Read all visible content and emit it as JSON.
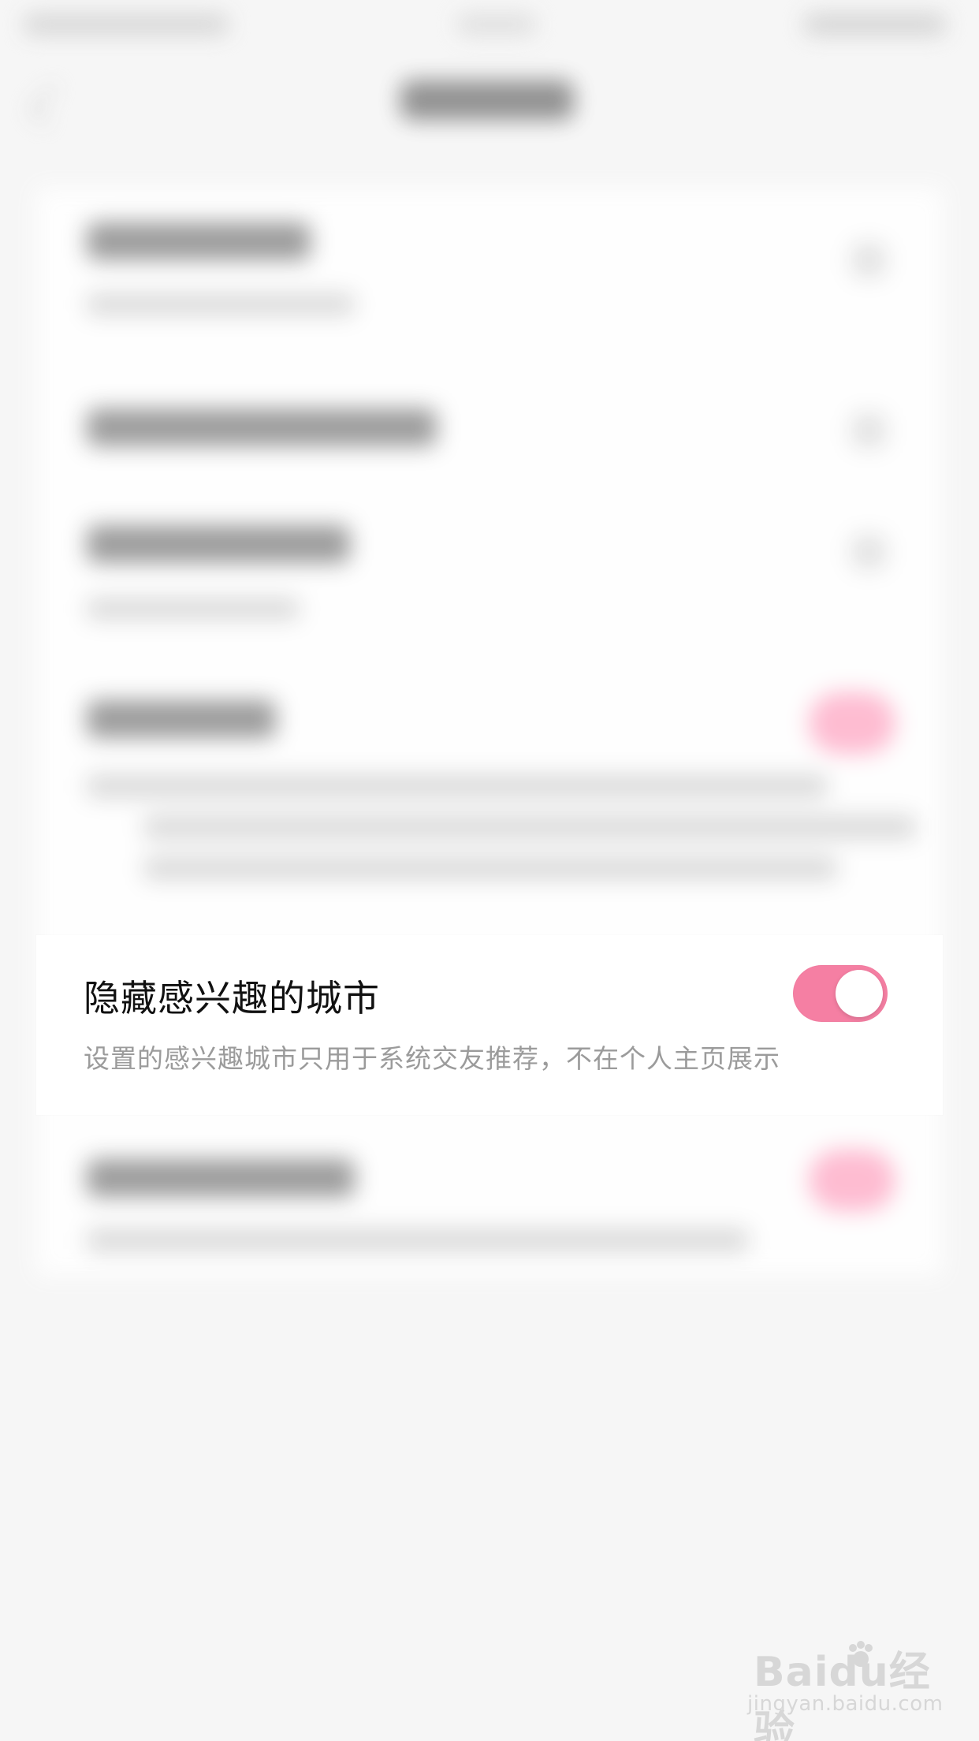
{
  "toggle_row": {
    "title": "隐藏感兴趣的城市",
    "description": "设置的感兴趣城市只用于系统交友推荐，不在个人主页展示",
    "toggle_state": "on",
    "toggle_color": "#f57fa3"
  },
  "watermark": {
    "brand": "Baidu经验",
    "url": "jingyan.baidu.com"
  },
  "colors": {
    "background": "#f6f6f6",
    "card": "#ffffff",
    "title_text": "#111111",
    "description_text": "#9b9b9b"
  }
}
